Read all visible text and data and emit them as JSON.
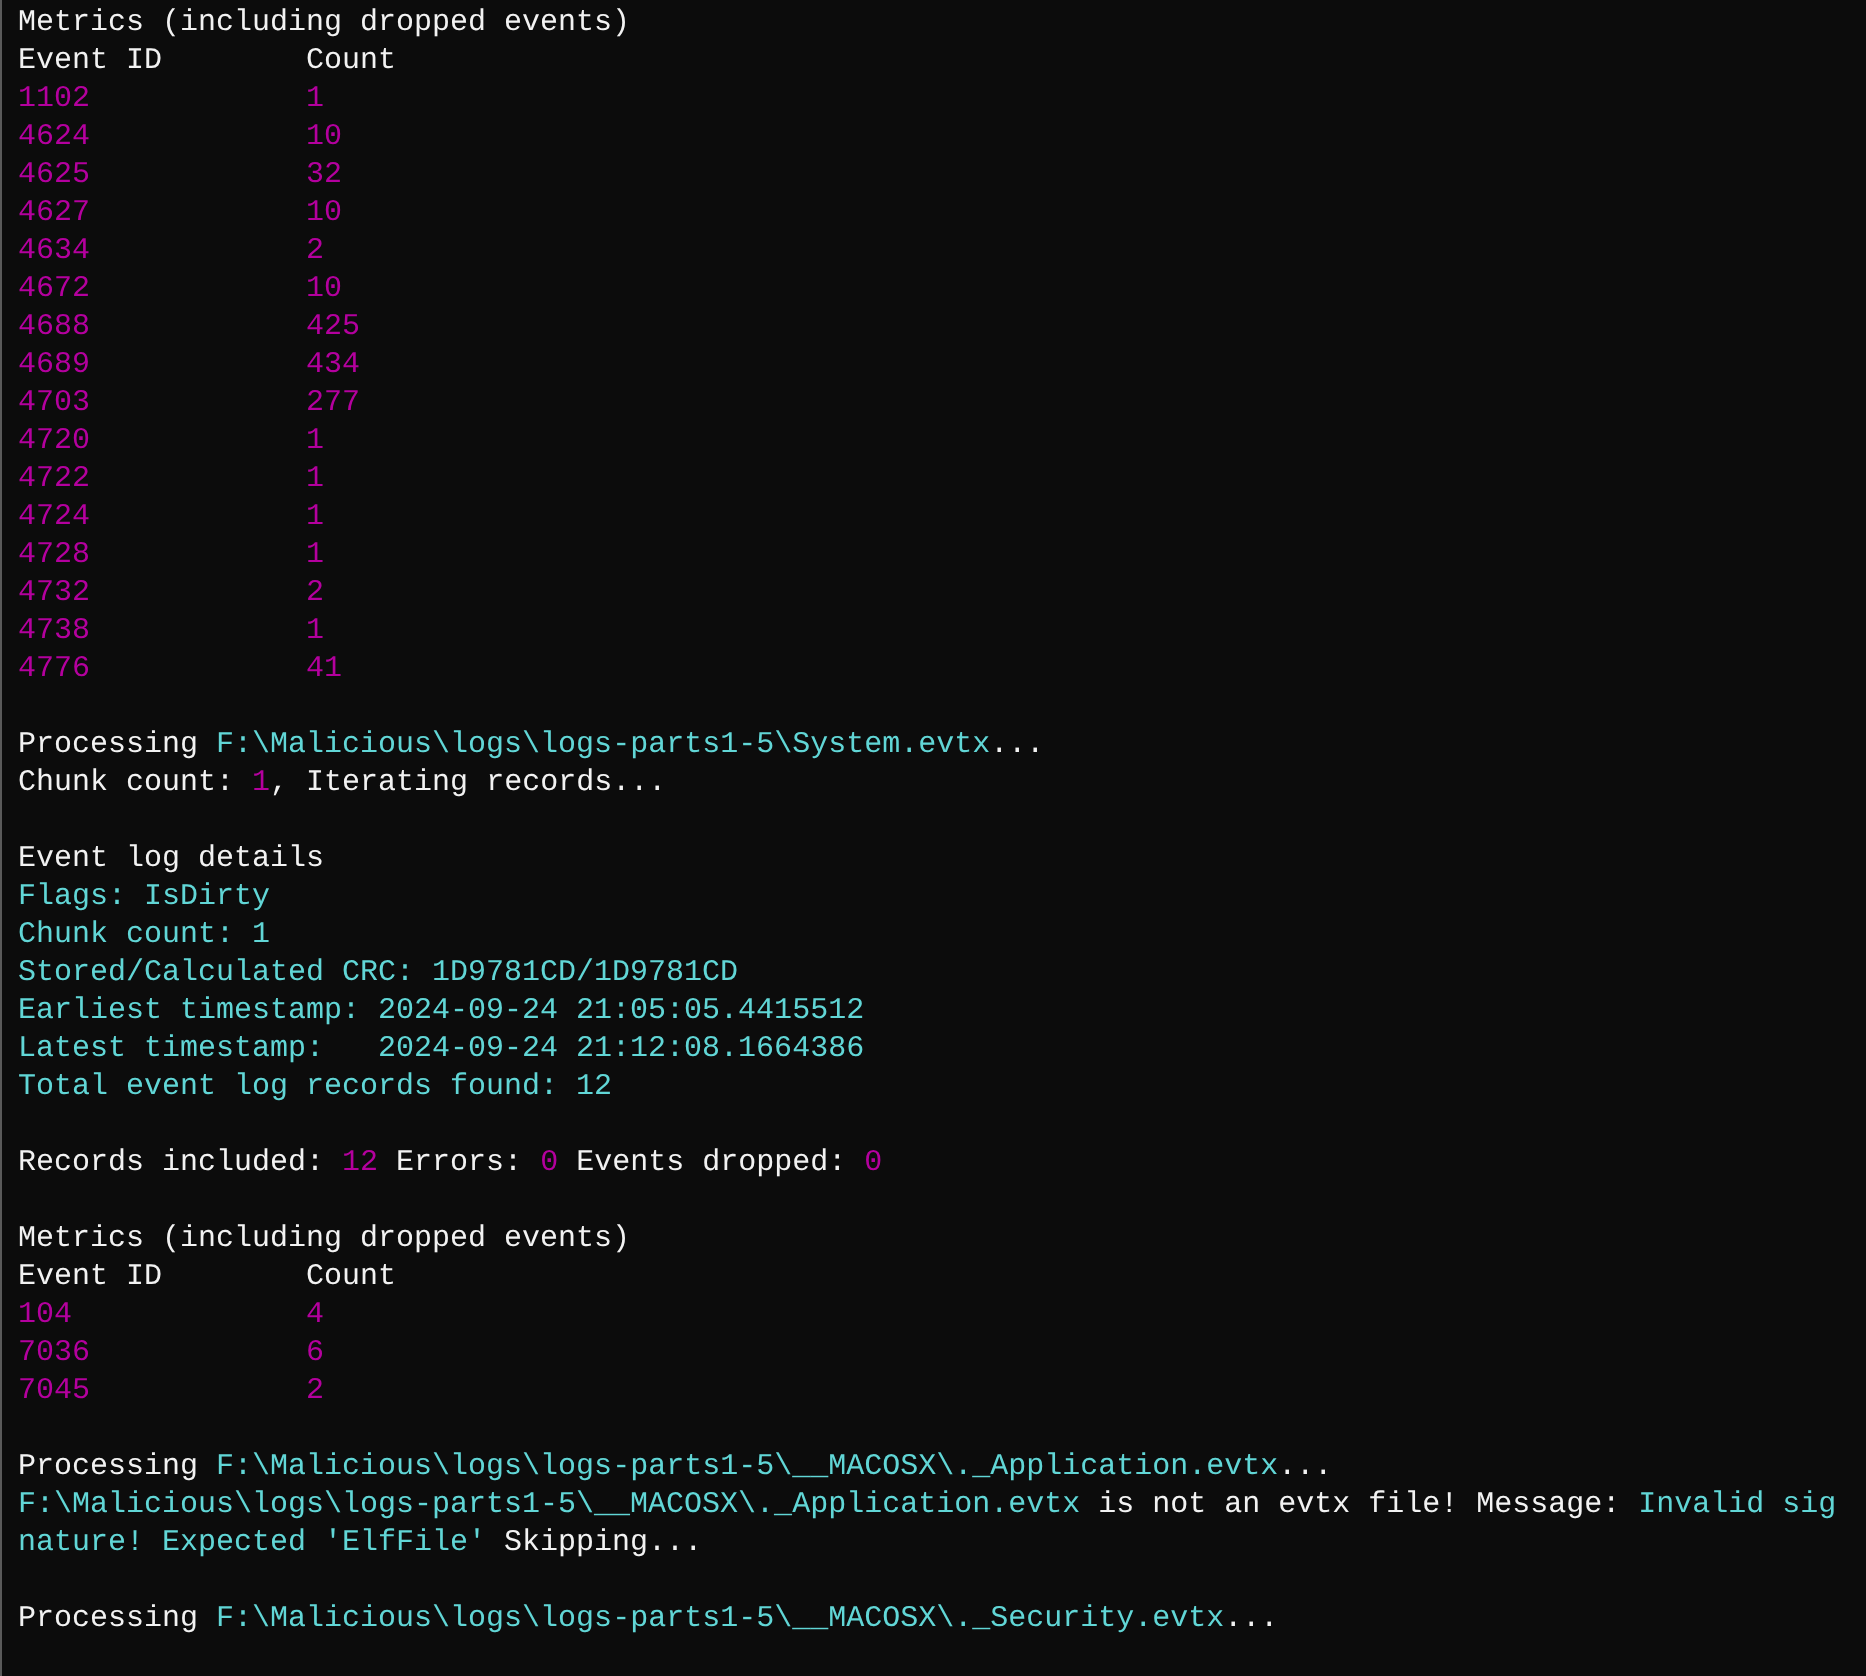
{
  "console": [
    {
      "kind": "line",
      "segments": [
        {
          "text": "Metrics (including dropped events)",
          "kind": "plain"
        }
      ]
    },
    {
      "kind": "table",
      "columns": [
        "Event ID",
        "Count"
      ],
      "rows": [
        {
          "event_id": "1102",
          "count": "1"
        },
        {
          "event_id": "4624",
          "count": "10"
        },
        {
          "event_id": "4625",
          "count": "32"
        },
        {
          "event_id": "4627",
          "count": "10"
        },
        {
          "event_id": "4634",
          "count": "2"
        },
        {
          "event_id": "4672",
          "count": "10"
        },
        {
          "event_id": "4688",
          "count": "425"
        },
        {
          "event_id": "4689",
          "count": "434"
        },
        {
          "event_id": "4703",
          "count": "277"
        },
        {
          "event_id": "4720",
          "count": "1"
        },
        {
          "event_id": "4722",
          "count": "1"
        },
        {
          "event_id": "4724",
          "count": "1"
        },
        {
          "event_id": "4728",
          "count": "1"
        },
        {
          "event_id": "4732",
          "count": "2"
        },
        {
          "event_id": "4738",
          "count": "1"
        },
        {
          "event_id": "4776",
          "count": "41"
        }
      ]
    },
    {
      "kind": "blank"
    },
    {
      "kind": "line",
      "segments": [
        {
          "text": "Processing ",
          "kind": "plain"
        },
        {
          "text": "F:\\Malicious\\logs\\logs-parts1-5\\System.evtx",
          "kind": "path"
        },
        {
          "text": "...",
          "kind": "plain"
        }
      ]
    },
    {
      "kind": "line",
      "segments": [
        {
          "text": "Chunk count: ",
          "kind": "plain"
        },
        {
          "text": "1",
          "kind": "number"
        },
        {
          "text": ", Iterating records...",
          "kind": "plain"
        }
      ]
    },
    {
      "kind": "blank"
    },
    {
      "kind": "line",
      "segments": [
        {
          "text": "Event log details",
          "kind": "plain"
        }
      ]
    },
    {
      "kind": "line",
      "segments": [
        {
          "text": "Flags: IsDirty",
          "kind": "path"
        }
      ]
    },
    {
      "kind": "line",
      "segments": [
        {
          "text": "Chunk count: 1",
          "kind": "path"
        }
      ]
    },
    {
      "kind": "line",
      "segments": [
        {
          "text": "Stored/Calculated CRC: 1D9781CD/1D9781CD",
          "kind": "path"
        }
      ]
    },
    {
      "kind": "line",
      "segments": [
        {
          "text": "Earliest timestamp: 2024-09-24 21:05:05.4415512",
          "kind": "path"
        }
      ]
    },
    {
      "kind": "line",
      "segments": [
        {
          "text": "Latest timestamp:   2024-09-24 21:12:08.1664386",
          "kind": "path"
        }
      ]
    },
    {
      "kind": "line",
      "segments": [
        {
          "text": "Total event log records found: 12",
          "kind": "path"
        }
      ]
    },
    {
      "kind": "blank"
    },
    {
      "kind": "line",
      "segments": [
        {
          "text": "Records included: ",
          "kind": "plain"
        },
        {
          "text": "12",
          "kind": "number"
        },
        {
          "text": " Errors: ",
          "kind": "plain"
        },
        {
          "text": "0",
          "kind": "number"
        },
        {
          "text": " Events dropped: ",
          "kind": "plain"
        },
        {
          "text": "0",
          "kind": "number"
        }
      ]
    },
    {
      "kind": "blank"
    },
    {
      "kind": "line",
      "segments": [
        {
          "text": "Metrics (including dropped events)",
          "kind": "plain"
        }
      ]
    },
    {
      "kind": "table",
      "columns": [
        "Event ID",
        "Count"
      ],
      "rows": [
        {
          "event_id": "104",
          "count": "4"
        },
        {
          "event_id": "7036",
          "count": "6"
        },
        {
          "event_id": "7045",
          "count": "2"
        }
      ]
    },
    {
      "kind": "blank"
    },
    {
      "kind": "line",
      "segments": [
        {
          "text": "Processing ",
          "kind": "plain"
        },
        {
          "text": "F:\\Malicious\\logs\\logs-parts1-5\\__MACOSX\\._Application.evtx",
          "kind": "path"
        },
        {
          "text": "...",
          "kind": "plain"
        }
      ]
    },
    {
      "kind": "line",
      "segments": [
        {
          "text": "F:\\Malicious\\logs\\logs-parts1-5\\__MACOSX\\._Application.evtx",
          "kind": "path"
        },
        {
          "text": " is not an evtx file! Message: ",
          "kind": "plain"
        },
        {
          "text": "Invalid signature! Expected 'ElfFile'",
          "kind": "path"
        },
        {
          "text": " Skipping...",
          "kind": "plain"
        }
      ]
    },
    {
      "kind": "blank"
    },
    {
      "kind": "line",
      "segments": [
        {
          "text": "Processing ",
          "kind": "plain"
        },
        {
          "text": "F:\\Malicious\\logs\\logs-parts1-5\\__MACOSX\\._Security.evtx",
          "kind": "path"
        },
        {
          "text": "...",
          "kind": "plain"
        }
      ]
    }
  ]
}
